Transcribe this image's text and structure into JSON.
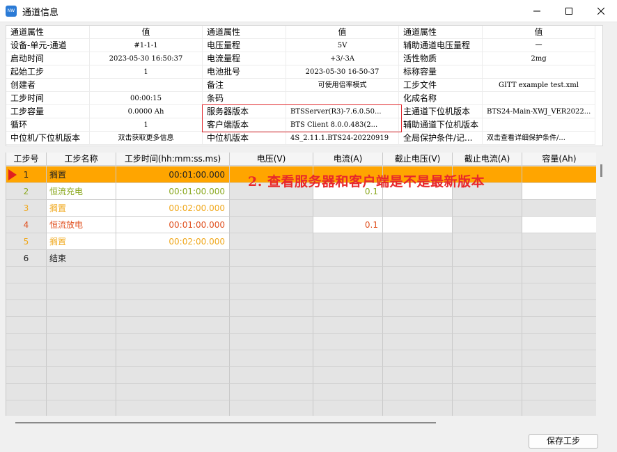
{
  "window": {
    "title": "通道信息",
    "icon_text": "NW",
    "controls": [
      "minimize-icon",
      "maximize-icon",
      "close-icon"
    ]
  },
  "info_table": {
    "header": [
      "通道属性",
      "值",
      "通道属性",
      "值",
      "通道属性",
      "值"
    ],
    "rows": [
      [
        "设备-单元-通道",
        "#1-1-1",
        "电压量程",
        "5V",
        "辅助通道电压量程",
        "一"
      ],
      [
        "启动时间",
        "2023-05-30 16:50:37",
        "电流量程",
        "+3/-3A",
        "活性物质",
        "2mg"
      ],
      [
        "起始工步",
        "1",
        "电池批号",
        "2023-05-30 16-50-37",
        "标称容量",
        ""
      ],
      [
        "创建者",
        "",
        "备注",
        "可使用倍率模式",
        "工步文件",
        "GITT example test.xml"
      ],
      [
        "工步时间",
        "00:00:15",
        "条码",
        "",
        "化成名称",
        ""
      ],
      [
        "工步容量",
        "0.0000 Ah",
        "服务器版本",
        "BTSServer(R3)-7.6.0.50...",
        "主通道下位机版本",
        "BTS24-Main-XWJ_VER2022..."
      ],
      [
        "循环",
        "1",
        "客户端版本",
        "BTS Client 8.0.0.483(2...",
        "辅助通道下位机版本",
        ""
      ],
      [
        "中位机/下位机版本",
        "双击获取更多信息",
        "中位机版本",
        "4S_2.11.1.BTS24-20220919",
        "全局保护条件/记...",
        "双击查看详细保护条件/..."
      ]
    ]
  },
  "annotation": "2. 查看服务器和客户端是不是最新版本",
  "steps_grid": {
    "columns": [
      "工步号",
      "工步名称",
      "工步时间(hh:mm:ss.ms)",
      "电压(V)",
      "电流(A)",
      "截止电压(V)",
      "截止电流(A)",
      "容量(Ah)"
    ],
    "rows": [
      {
        "no": "1",
        "name": "搁置",
        "time": "00:01:00.000",
        "current": "",
        "color": "#222222",
        "selected": true
      },
      {
        "no": "2",
        "name": "恒流充电",
        "time": "00:01:00.000",
        "current": "0.1",
        "color": "#8aa81e",
        "selected": false
      },
      {
        "no": "3",
        "name": "搁置",
        "time": "00:02:00.000",
        "current": "",
        "color": "#f0a81c",
        "selected": false
      },
      {
        "no": "4",
        "name": "恒流放电",
        "time": "00:01:00.000",
        "current": "0.1",
        "color": "#e0501f",
        "selected": false
      },
      {
        "no": "5",
        "name": "搁置",
        "time": "00:02:00.000",
        "current": "",
        "color": "#f0a81c",
        "selected": false
      },
      {
        "no": "6",
        "name": "结束",
        "time": "",
        "current": "",
        "color": "#222222",
        "selected": false
      }
    ],
    "empty_rows": 9
  },
  "footer": {
    "save_label": "保存工步"
  },
  "colors": {
    "highlight": "#ffa500",
    "annotation": "#e8282b",
    "box": "#e0262b"
  }
}
